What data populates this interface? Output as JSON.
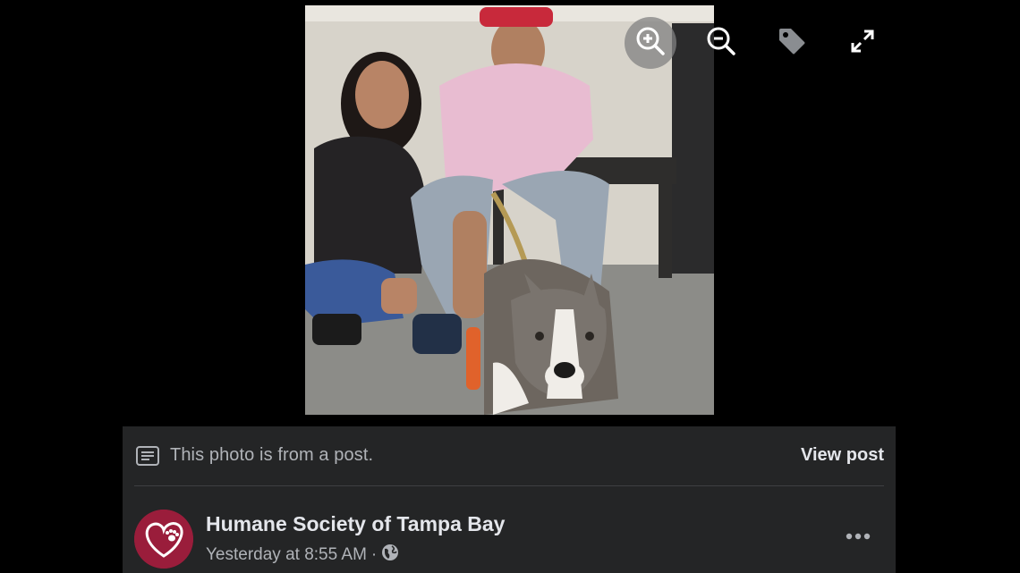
{
  "viewer": {
    "photo_alt": "Two young people kneeling with a grey and white dog on a leash",
    "tools": {
      "zoom_in": "zoom-in-icon",
      "zoom_out": "zoom-out-icon",
      "tag": "tag-icon",
      "fullscreen": "expand-icon"
    }
  },
  "post_panel": {
    "notice_text": "This photo is from a post.",
    "view_post_label": "View post",
    "page_name": "Humane Society of Tampa Bay",
    "timestamp": "Yesterday at 8:55 AM",
    "separator": "·",
    "audience_icon": "globe-icon",
    "more_icon": "more-horizontal-icon"
  },
  "colors": {
    "background": "#000000",
    "panel": "#242526",
    "primary_text": "#e4e6eb",
    "secondary_text": "#b0b3b8",
    "avatar_brand": "#9a1d3b"
  }
}
